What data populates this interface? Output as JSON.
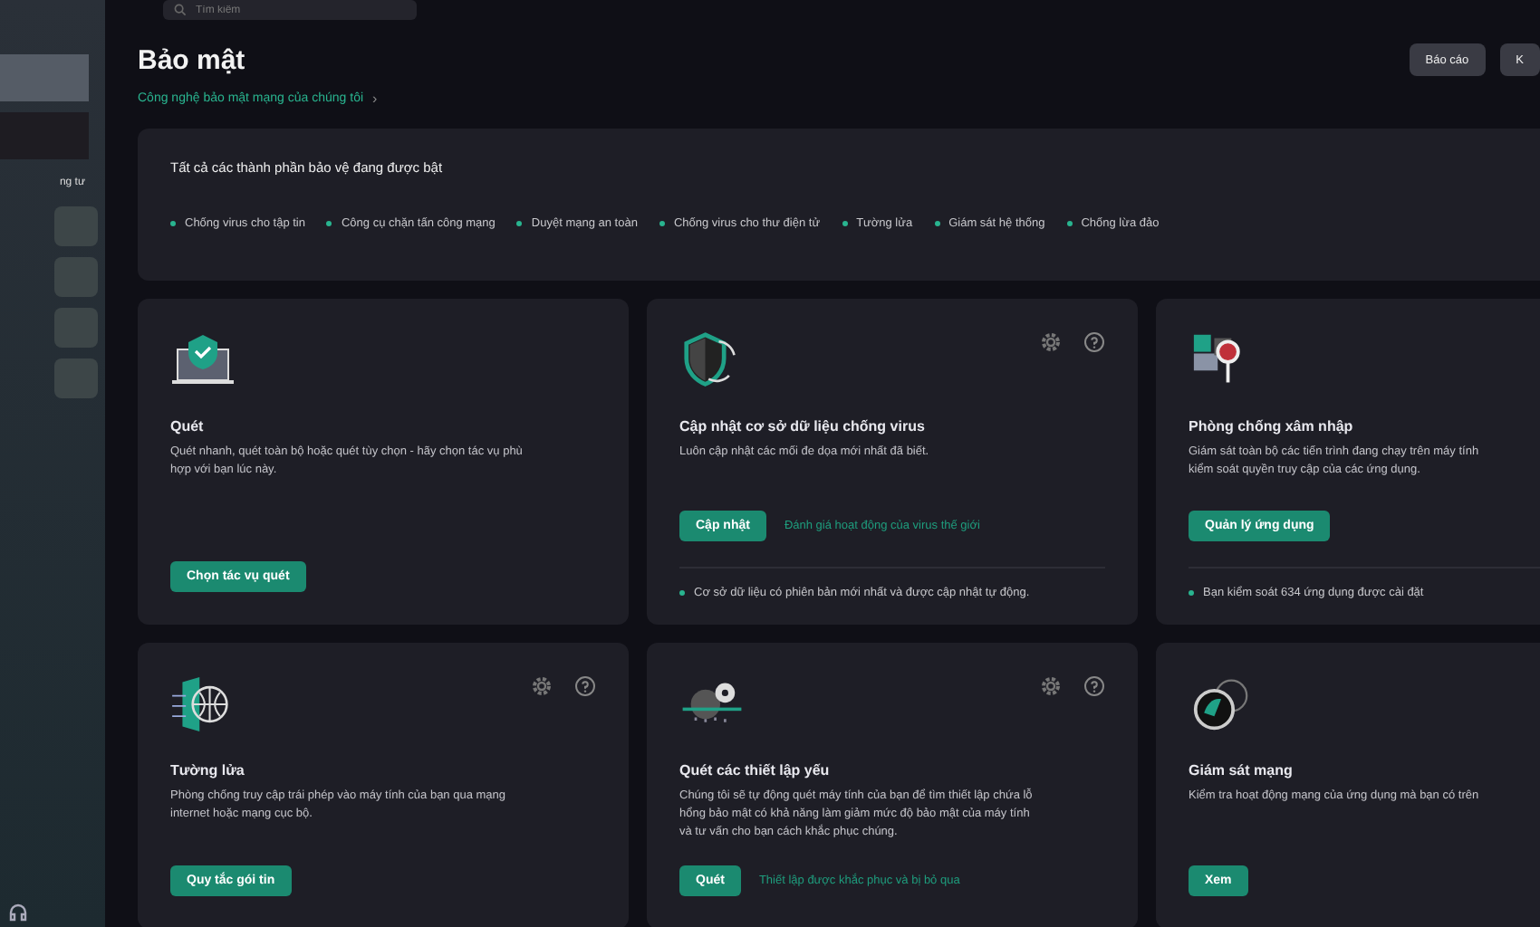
{
  "sidebar": {
    "items": [
      {
        "selected": true
      },
      {
        "selected": false
      }
    ],
    "label": "ng tư"
  },
  "search": {
    "placeholder": "Tìm kiếm"
  },
  "header": {
    "title": "Bảo mật",
    "link": "Công nghệ bảo mật mạng của chúng tôi",
    "link_chevron": "›",
    "buttons": [
      "Báo cáo",
      "K"
    ]
  },
  "status": {
    "title": "Tất cả các thành phần bảo vệ đang được bật",
    "components": [
      "Chống virus cho tập tin",
      "Công cụ chặn tấn công mạng",
      "Duyệt mạng an toàn",
      "Chống virus cho thư điện tử",
      "Tường lửa",
      "Giám sát hệ thống",
      "Chống lừa đảo"
    ]
  },
  "cards": [
    {
      "kind": "scan",
      "settings_help_icons": false,
      "title": "Quét",
      "description": [
        "Quét nhanh, quét toàn bộ hoặc quét tùy chọn - hãy chọn tác vụ phù",
        "hợp với bạn lúc này."
      ],
      "button": "Chọn tác vụ quét"
    },
    {
      "kind": "update",
      "settings_help_icons": true,
      "title": "Cập nhật cơ sở dữ liệu chống virus",
      "description": [
        "Luôn cập nhật các mối đe dọa mới nhất đã biết."
      ],
      "button": "Cập nhật",
      "link": "Đánh giá hoạt động của virus thế giới",
      "note": "Cơ sở dữ liệu có phiên bản mới nhất và được cập nhật tự động."
    },
    {
      "kind": "intrusion",
      "settings_help_icons": false,
      "title": "Phòng chống xâm nhập",
      "description": [
        "Giám sát toàn bộ các tiến trình đang chạy trên máy tính",
        "kiểm soát quyền truy cập của các ứng dụng."
      ],
      "button": "Quản lý ứng dụng",
      "note": "Bạn kiểm soát 634 ứng dụng được cài đặt"
    },
    {
      "kind": "firewall",
      "settings_help_icons": true,
      "title": "Tường lửa",
      "description": [
        "Phòng chống truy cập trái phép vào máy tính của bạn qua mạng",
        "internet hoặc mạng cục bộ."
      ],
      "button": "Quy tắc gói tin"
    },
    {
      "kind": "vulnerability",
      "settings_help_icons": true,
      "title": "Quét các thiết lập yếu",
      "description": [
        "Chúng tôi sẽ tự động quét máy tính của bạn để tìm thiết lập chứa lỗ",
        "hổng bảo mật có khả năng làm giảm mức độ bảo mật của máy tính",
        "và tư vấn cho bạn cách khắc phục chúng."
      ],
      "button": "Quét",
      "link": "Thiết lập được khắc phục và bị bỏ qua"
    },
    {
      "kind": "network",
      "settings_help_icons": false,
      "title": "Giám sát mạng",
      "description": [
        "Kiểm tra hoạt động mạng của ứng dụng mà bạn có trên"
      ],
      "button": "Xem"
    }
  ]
}
